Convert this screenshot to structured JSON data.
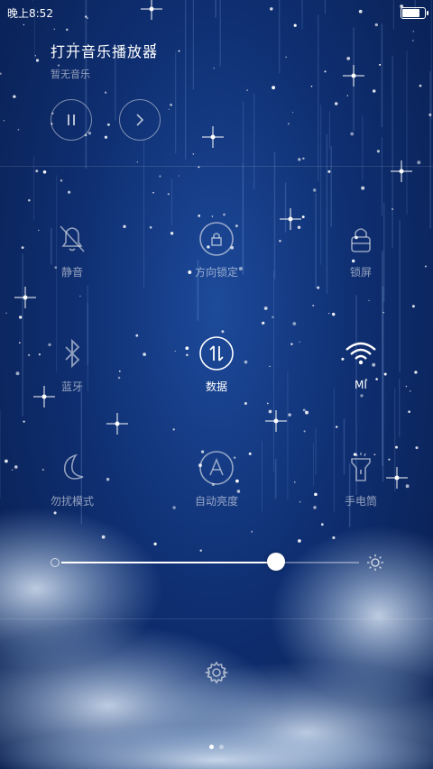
{
  "status": {
    "time": "晚上8:52",
    "battery_level": 0.85
  },
  "music": {
    "title": "打开音乐播放器",
    "subtitle": "暂无音乐"
  },
  "toggles": [
    {
      "label": "静音",
      "icon": "bell-off-icon",
      "on": false
    },
    {
      "label": "方向锁定",
      "icon": "rotation-lock-icon",
      "on": false
    },
    {
      "label": "锁屏",
      "icon": "lock-icon",
      "on": false
    },
    {
      "label": "蓝牙",
      "icon": "bluetooth-icon",
      "on": false
    },
    {
      "label": "数据",
      "icon": "mobile-data-icon",
      "on": true
    },
    {
      "label": "MI",
      "icon": "wifi-icon",
      "on": true
    },
    {
      "label": "勿扰模式",
      "icon": "moon-icon",
      "on": false
    },
    {
      "label": "自动亮度",
      "icon": "auto-brightness-icon",
      "on": false
    },
    {
      "label": "手电筒",
      "icon": "flashlight-icon",
      "on": false
    }
  ],
  "brightness": {
    "level": 0.72
  },
  "pager": {
    "pages": 2,
    "active": 0
  }
}
